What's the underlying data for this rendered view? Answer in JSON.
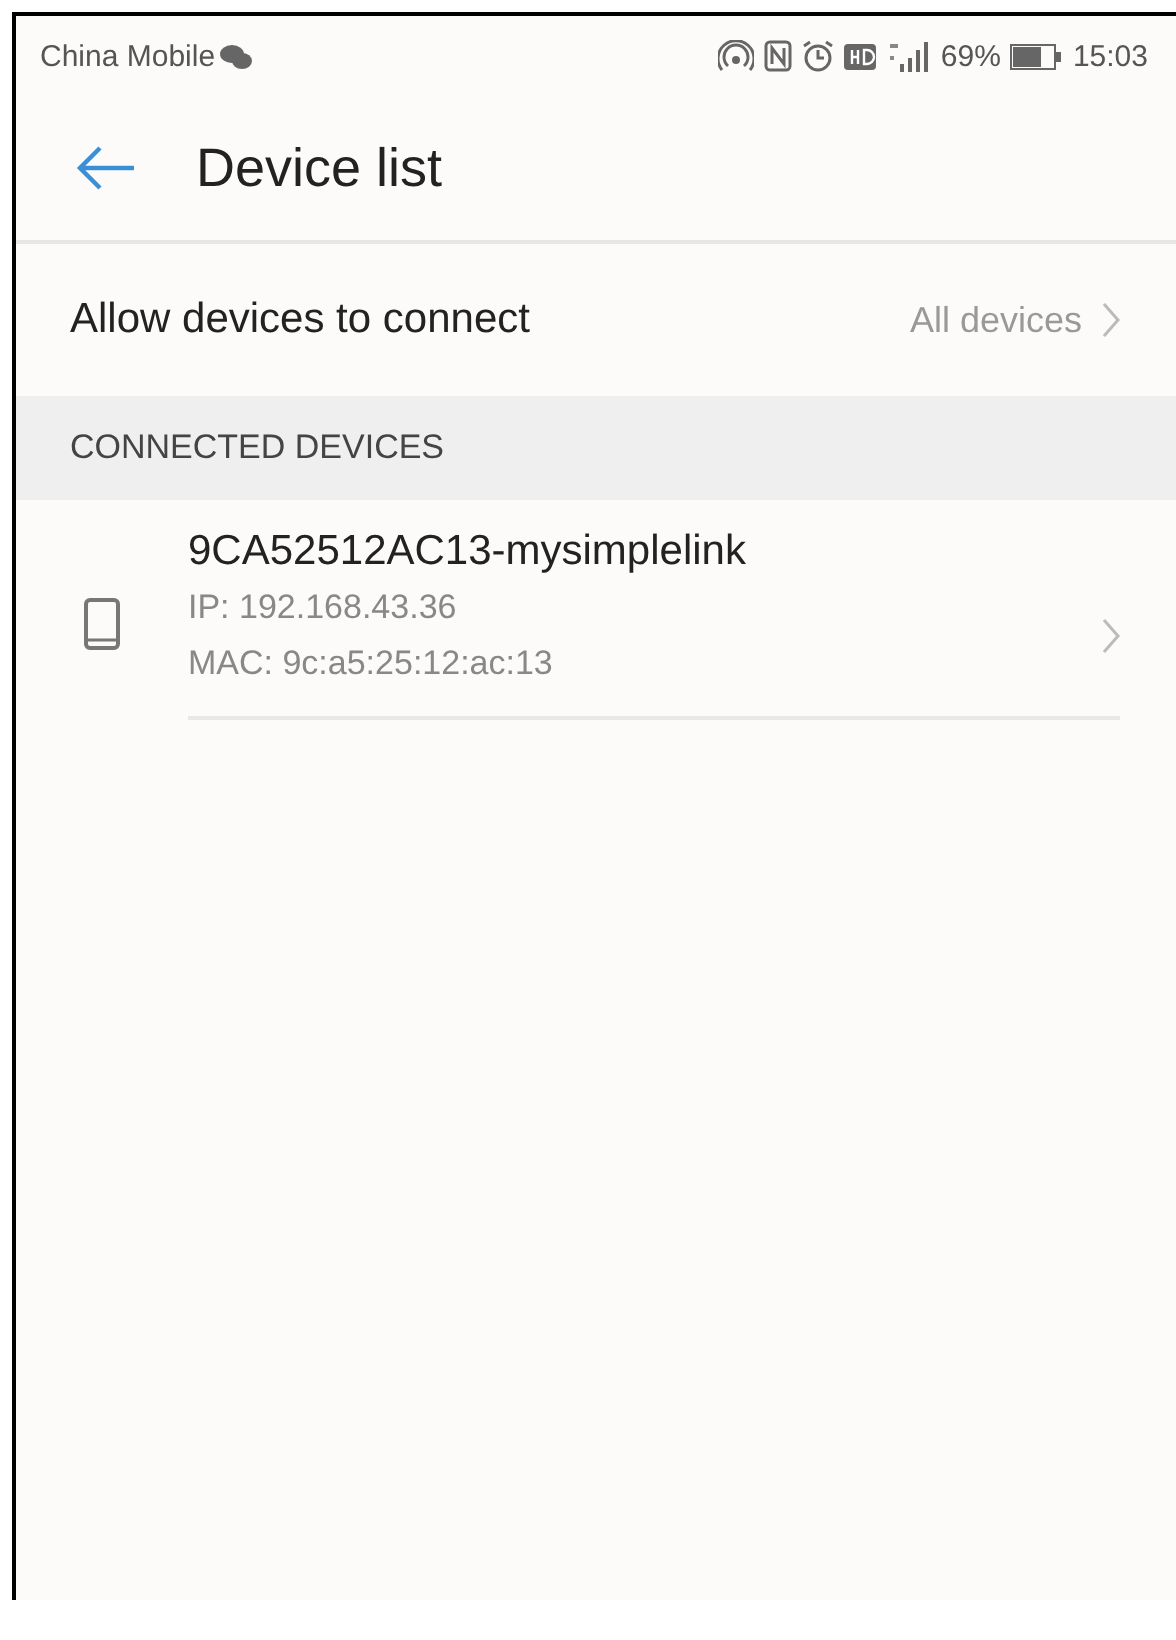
{
  "status_bar": {
    "carrier": "China Mobile",
    "battery": "69%",
    "time": "15:03"
  },
  "header": {
    "title": "Device list"
  },
  "setting": {
    "label": "Allow devices to connect",
    "value": "All devices"
  },
  "section": {
    "title": "CONNECTED DEVICES"
  },
  "devices": [
    {
      "name": "9CA52512AC13-mysimplelink",
      "ip": "IP: 192.168.43.36",
      "mac": "MAC: 9c:a5:25:12:ac:13"
    }
  ]
}
